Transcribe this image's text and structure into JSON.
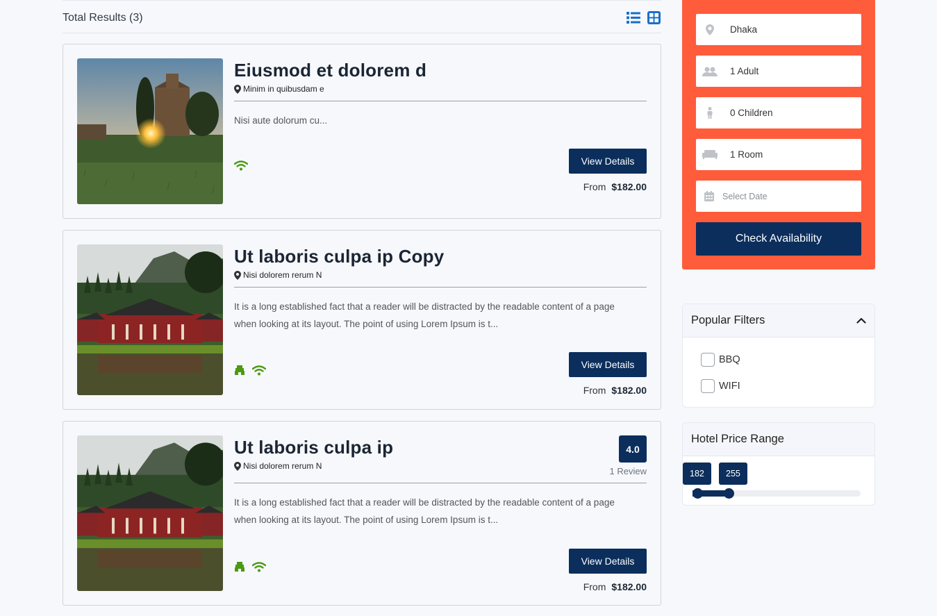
{
  "results": {
    "label": "Total Results (3)"
  },
  "view_toggle": {
    "list_icon": "list-view-icon",
    "grid_icon": "grid-view-icon",
    "active": "grid"
  },
  "hotels": [
    {
      "title": "Eiusmod et dolorem d",
      "location": "Minim in quibusdam e",
      "description": "Nisi aute dolorum cu...",
      "amenities": [
        "wifi-icon"
      ],
      "button": "View Details",
      "price_prefix": "From",
      "price": "$182.00"
    },
    {
      "title": "Ut laboris culpa ip Copy",
      "location": "Nisi dolorem rerum N",
      "description": "It is a long established fact that a reader will be distracted by the readable content of a page when looking at its layout. The point of using Lorem Ipsum is t...",
      "amenities": [
        "bbq-icon",
        "wifi-icon"
      ],
      "button": "View Details",
      "price_prefix": "From",
      "price": "$182.00"
    },
    {
      "title": "Ut laboris culpa ip",
      "location": "Nisi dolorem rerum N",
      "description": "It is a long established fact that a reader will be distracted by the readable content of a page when looking at its layout. The point of using Lorem Ipsum is t...",
      "amenities": [
        "bbq-icon",
        "wifi-icon"
      ],
      "button": "View Details",
      "price_prefix": "From",
      "price": "$182.00",
      "rating": "4.0",
      "reviews": "1 Review"
    }
  ],
  "search": {
    "location": "Dhaka",
    "adults": "1 Adult",
    "children": "0 Children",
    "rooms": "1 Room",
    "date_placeholder": "Select Date",
    "button": "Check Availability"
  },
  "filters": {
    "title": "Popular Filters",
    "options": [
      {
        "label": "BBQ",
        "checked": false
      },
      {
        "label": "WIFI",
        "checked": false
      }
    ]
  },
  "price_range": {
    "title": "Hotel Price Range",
    "min_label": "182",
    "max_label": "255",
    "min_fraction": 0,
    "max_fraction": 0.215
  },
  "colors": {
    "navy": "#0b2e5c",
    "accent": "#ff5c3c",
    "amenity_green": "#4c9a12",
    "toggle_blue": "#1a6fc9"
  }
}
